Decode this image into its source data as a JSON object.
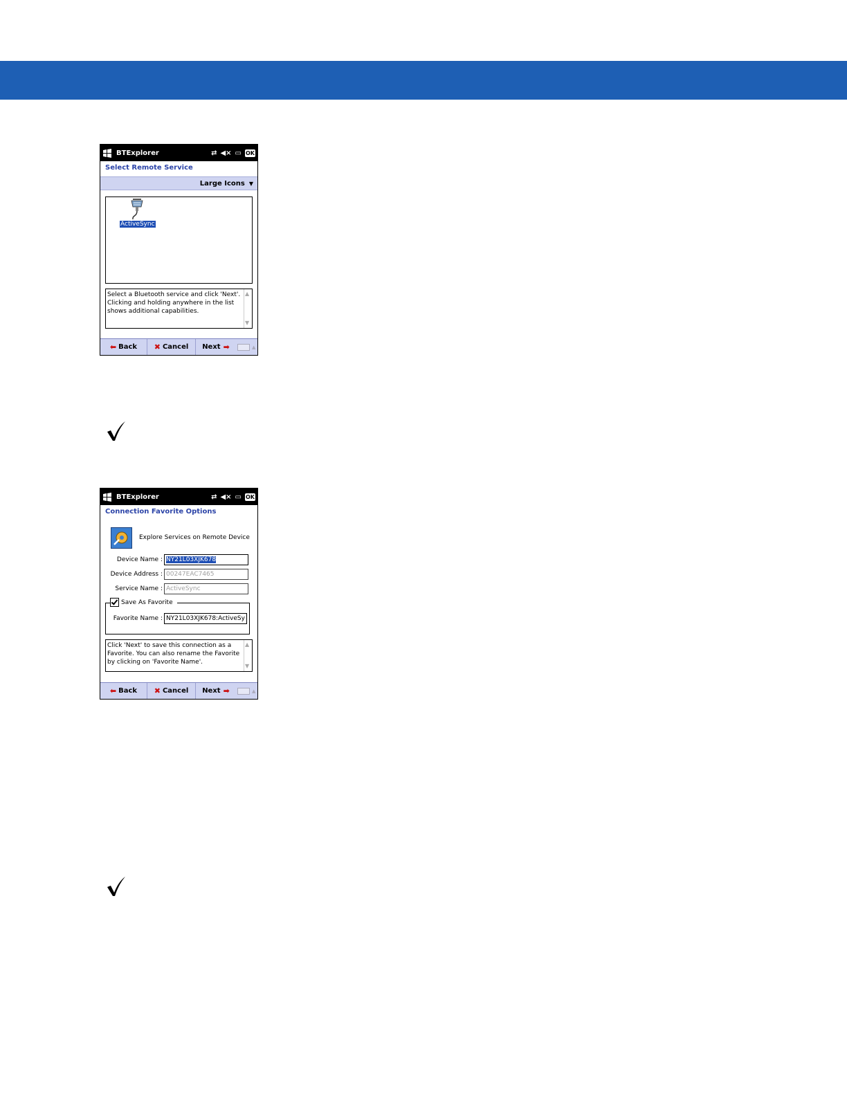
{
  "screen1": {
    "app_title": "BTExplorer",
    "ok_label": "OK",
    "heading": "Select Remote Service",
    "view_mode": "Large Icons",
    "service_item": "ActiveSync",
    "help_text": "Select a Bluetooth service and click 'Next'. Clicking and holding anywhere in the list shows additional capabilities.",
    "back_label": "Back",
    "cancel_label": "Cancel",
    "next_label": "Next"
  },
  "screen2": {
    "app_title": "BTExplorer",
    "ok_label": "OK",
    "heading": "Connection Favorite Options",
    "explore_label": "Explore Services on Remote Device",
    "device_name_label": "Device Name :",
    "device_name_value": "NY21L03XJK678",
    "device_address_label": "Device Address :",
    "device_address_value": "00247EAC7465",
    "service_name_label": "Service Name :",
    "service_name_value": "ActiveSync",
    "save_favorite_label": "Save As Favorite",
    "save_favorite_checked": true,
    "favorite_name_label": "Favorite Name :",
    "favorite_name_value": "NY21L03XJK678:ActiveSy",
    "help_text": "Click 'Next' to save this connection as a Favorite.  You can also rename the Favorite by clicking on 'Favorite Name'.",
    "back_label": "Back",
    "cancel_label": "Cancel",
    "next_label": "Next"
  },
  "colors": {
    "banner": "#1e5fb4",
    "heading": "#2c44a8",
    "softbar": "#cfd4f1",
    "selection": "#1f4fb5"
  }
}
